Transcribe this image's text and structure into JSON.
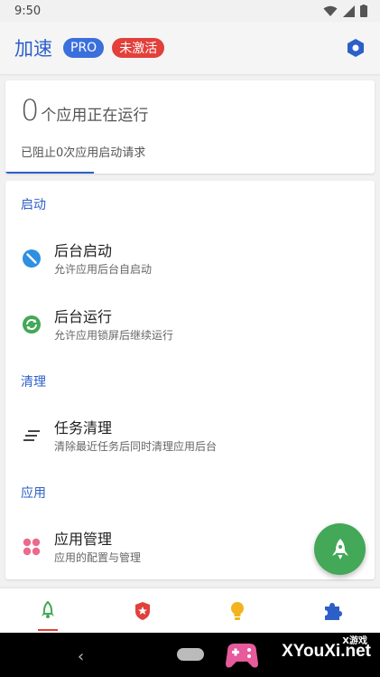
{
  "status_bar": {
    "time": "9:50"
  },
  "app_bar": {
    "title": "加速",
    "pro_badge": "PRO",
    "inactive_badge": "未激活"
  },
  "summary": {
    "running_count": "0",
    "running_text": "个应用正在运行",
    "blocked_text": "已阻止0次应用启动请求"
  },
  "sections": {
    "startup": "启动",
    "cleanup": "清理",
    "apps": "应用"
  },
  "items": {
    "bg_start": {
      "title": "后台启动",
      "subtitle": "允许应用后台自启动",
      "icon": "block-circle-icon",
      "color": "#2f8fe0"
    },
    "bg_run": {
      "title": "后台运行",
      "subtitle": "允许应用锁屏后继续运行",
      "icon": "sync-circle-icon",
      "color": "#43a857"
    },
    "task_clean": {
      "title": "任务清理",
      "subtitle": "清除最近任务后同时清理应用后台",
      "icon": "sort-lines-icon",
      "color": "#444444"
    },
    "app_manage": {
      "title": "应用管理",
      "subtitle": "应用的配置与管理",
      "icon": "four-dots-icon",
      "color": "#ec6a8c"
    }
  },
  "bottom_nav": [
    {
      "icon": "rocket-icon",
      "color": "#43a857",
      "active": true
    },
    {
      "icon": "shield-star-icon",
      "color": "#e2403b",
      "active": false
    },
    {
      "icon": "bulb-icon",
      "color": "#f2b31f",
      "active": false
    },
    {
      "icon": "puzzle-icon",
      "color": "#2d5fc8",
      "active": false
    }
  ],
  "watermark": {
    "small": "X游戏",
    "big": "XYouXi.net"
  }
}
